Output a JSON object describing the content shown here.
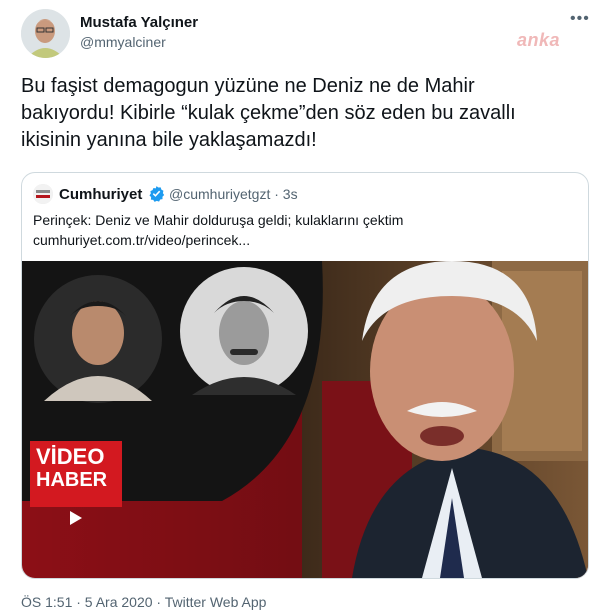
{
  "author": {
    "name": "Mustafa Yalçıner",
    "handle": "@mmyalciner"
  },
  "more_glyph": "•••",
  "watermark": "anka",
  "tweet": {
    "lines": [
      "Bu faşist demagogun yüzüne ne Deniz ne de Mahir",
      "bakıyordu! Kibirle “kulak çekme”den söz eden bu zavallı",
      "ikisinin yanına bile yaklaşamazdı!"
    ]
  },
  "quote": {
    "name": "Cumhuriyet",
    "handle": "@cumhuriyetgzt · 3s",
    "text_line1": "Perinçek: Deniz ve Mahir dolduruşa geldi; kulaklarını çektim",
    "text_line2": "cumhuriyet.com.tr/video/perincek...",
    "badge_line1": "VİDEO",
    "badge_line2": "HABER"
  },
  "footer": "ÖS 1:51 · 5 Ara 2020 · Twitter Web App",
  "colors": {
    "verified": "#1d9bf0",
    "badge_red": "#d31920",
    "bg_red": "#b0121b"
  }
}
